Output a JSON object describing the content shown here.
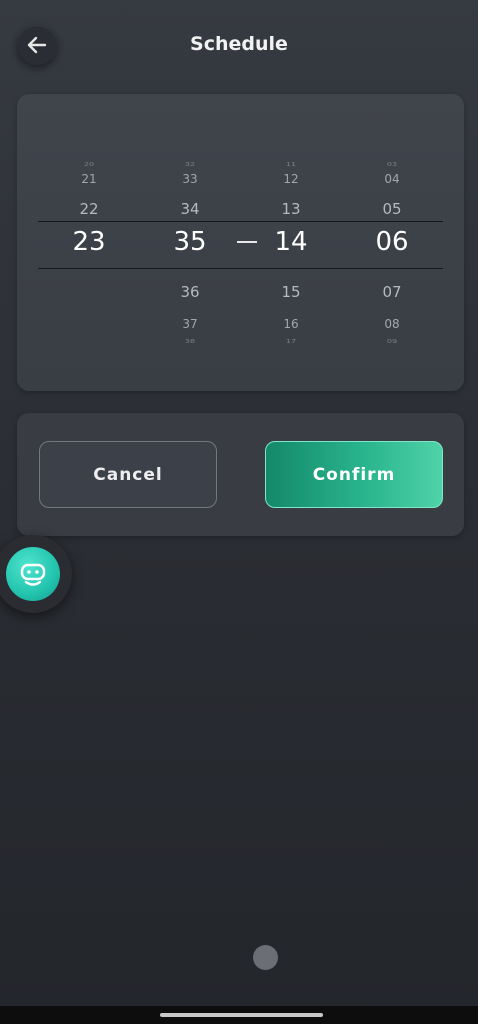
{
  "header": {
    "back_icon": "arrow-left-icon",
    "title": "Schedule"
  },
  "picker": {
    "columns": [
      {
        "name": "start-hour",
        "items": [
          "20",
          "21",
          "22"
        ],
        "selected": "23",
        "below": [
          "",
          "",
          ""
        ]
      },
      {
        "name": "start-minute",
        "items": [
          "32",
          "33",
          "34"
        ],
        "selected": "35",
        "below": [
          "36",
          "37",
          "38"
        ]
      },
      {
        "name": "end-hour",
        "items": [
          "11",
          "12",
          "13"
        ],
        "selected": "14",
        "below": [
          "15",
          "16",
          "17"
        ]
      },
      {
        "name": "end-minute",
        "items": [
          "03",
          "04",
          "05"
        ],
        "selected": "06",
        "below": [
          "07",
          "08",
          "09"
        ]
      }
    ],
    "separator_icon": "dash-icon"
  },
  "actions": {
    "cancel_label": "Cancel",
    "confirm_label": "Confirm"
  },
  "assistant": {
    "icon": "robot-icon"
  },
  "pager": {
    "pages": 1,
    "current": 1
  },
  "colors": {
    "accent": "#29b48c",
    "assistant": "#22c3ad",
    "background": "#2b2e34"
  }
}
